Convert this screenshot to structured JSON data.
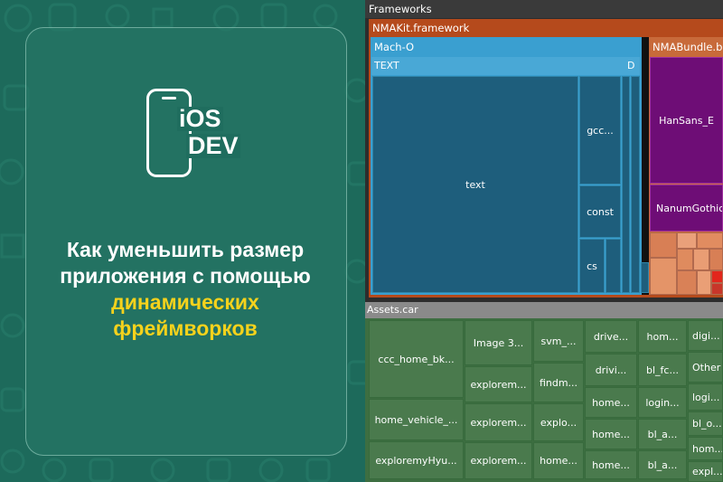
{
  "headline": {
    "line1": "Как уменьшить размер",
    "line2": "приложения с помощью",
    "line3": "динамических",
    "line4": "фреймворков"
  },
  "logo": {
    "line1": "iOS",
    "line2": "DEV"
  },
  "colors": {
    "background": "#1d6a5b",
    "accent": "#f5d21c",
    "text": "#ffffff"
  },
  "treemap": {
    "frameworks_label": "Frameworks",
    "nmakit_label": "NMAKit.framework",
    "macho_label": "Mach-O",
    "text_segment_label": "TEXT",
    "d_label": "D",
    "text_label": "text",
    "gcc_label": "gcc...",
    "const_label": "const",
    "cs_label": "cs",
    "nmabundle_label": "NMABundle.bu",
    "hansans_label": "HanSans_E",
    "nanum_label": "NanumGothic",
    "assets_label": "Assets.car",
    "assets": [
      "ccc_home_bk...",
      "home_vehicle_...",
      "exploremyHyu...",
      "Image 3...",
      "explorem...",
      "explorem...",
      "explorem...",
      "svm_...",
      "findm...",
      "explo...",
      "home...",
      "drive...",
      "drivi...",
      "home...",
      "home...",
      "home...",
      "hom...",
      "bl_fc...",
      "login...",
      "bl_a...",
      "bl_a...",
      "digi...",
      "Other",
      "logi...",
      "bl_o...",
      "hom...",
      "expl..."
    ]
  }
}
